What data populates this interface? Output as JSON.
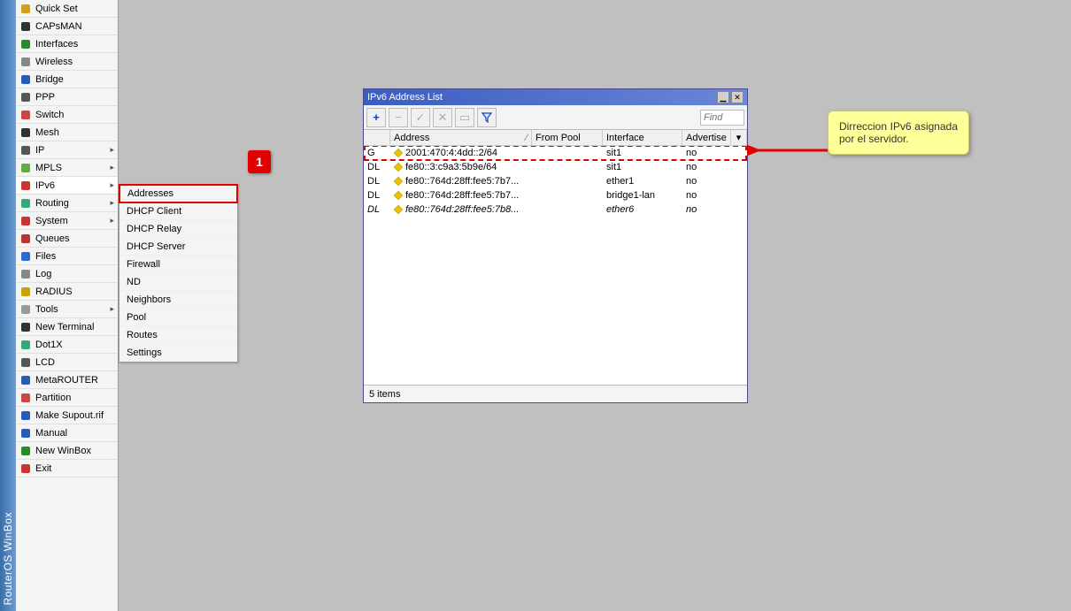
{
  "app_title": "RouterOS WinBox",
  "sidebar": {
    "items": [
      {
        "label": "Quick Set",
        "icon": "wand",
        "color": "#d4a017"
      },
      {
        "label": "CAPsMAN",
        "icon": "caps",
        "color": "#333"
      },
      {
        "label": "Interfaces",
        "icon": "iface",
        "color": "#2a8a2a"
      },
      {
        "label": "Wireless",
        "icon": "wifi",
        "color": "#888"
      },
      {
        "label": "Bridge",
        "icon": "bridge",
        "color": "#2a5ab8"
      },
      {
        "label": "PPP",
        "icon": "ppp",
        "color": "#555"
      },
      {
        "label": "Switch",
        "icon": "switch",
        "color": "#c44"
      },
      {
        "label": "Mesh",
        "icon": "mesh",
        "color": "#333"
      },
      {
        "label": "IP",
        "icon": "ip",
        "color": "#555",
        "arrow": true
      },
      {
        "label": "MPLS",
        "icon": "mpls",
        "color": "#6a4",
        "arrow": true
      },
      {
        "label": "IPv6",
        "icon": "ipv6",
        "color": "#c33",
        "arrow": true,
        "selected": true
      },
      {
        "label": "Routing",
        "icon": "routing",
        "color": "#3a7",
        "arrow": true
      },
      {
        "label": "System",
        "icon": "system",
        "color": "#c33",
        "arrow": true
      },
      {
        "label": "Queues",
        "icon": "queues",
        "color": "#b33"
      },
      {
        "label": "Files",
        "icon": "files",
        "color": "#2a6ad4"
      },
      {
        "label": "Log",
        "icon": "log",
        "color": "#888"
      },
      {
        "label": "RADIUS",
        "icon": "radius",
        "color": "#c9a400"
      },
      {
        "label": "Tools",
        "icon": "tools",
        "color": "#999",
        "arrow": true
      },
      {
        "label": "New Terminal",
        "icon": "term",
        "color": "#333"
      },
      {
        "label": "Dot1X",
        "icon": "dot1x",
        "color": "#3a7"
      },
      {
        "label": "LCD",
        "icon": "lcd",
        "color": "#555"
      },
      {
        "label": "MetaROUTER",
        "icon": "meta",
        "color": "#2a5ab8"
      },
      {
        "label": "Partition",
        "icon": "part",
        "color": "#c44"
      },
      {
        "label": "Make Supout.rif",
        "icon": "supout",
        "color": "#2a5ab8"
      },
      {
        "label": "Manual",
        "icon": "manual",
        "color": "#2a5ab8"
      },
      {
        "label": "New WinBox",
        "icon": "newwb",
        "color": "#2a8a2a"
      },
      {
        "label": "Exit",
        "icon": "exit",
        "color": "#c33"
      }
    ]
  },
  "submenu": {
    "items": [
      {
        "label": "Addresses",
        "highlighted": true
      },
      {
        "label": "DHCP Client"
      },
      {
        "label": "DHCP Relay"
      },
      {
        "label": "DHCP Server"
      },
      {
        "label": "Firewall"
      },
      {
        "label": "ND"
      },
      {
        "label": "Neighbors"
      },
      {
        "label": "Pool"
      },
      {
        "label": "Routes"
      },
      {
        "label": "Settings"
      }
    ]
  },
  "callout1": "1",
  "window": {
    "title": "IPv6 Address List",
    "toolbar": {
      "add": "+",
      "remove": "−",
      "enable": "✓",
      "disable": "✕",
      "comment": "▭",
      "filter": "▼"
    },
    "find_placeholder": "Find",
    "columns": {
      "flag": "",
      "address": "Address",
      "sort": "∕",
      "from_pool": "From Pool",
      "interface": "Interface",
      "advertise": "Advertise",
      "dropdown": "▾"
    },
    "rows": [
      {
        "flag": "G",
        "address": "2001:470:4:4dd::2/64",
        "from_pool": "",
        "interface": "sit1",
        "advertise": "no",
        "italic": false
      },
      {
        "flag": "DL",
        "address": "fe80::3:c9a3:5b9e/64",
        "from_pool": "",
        "interface": "sit1",
        "advertise": "no",
        "italic": false
      },
      {
        "flag": "DL",
        "address": "fe80::764d:28ff:fee5:7b7...",
        "from_pool": "",
        "interface": "ether1",
        "advertise": "no",
        "italic": false
      },
      {
        "flag": "DL",
        "address": "fe80::764d:28ff:fee5:7b7...",
        "from_pool": "",
        "interface": "bridge1-lan",
        "advertise": "no",
        "italic": false
      },
      {
        "flag": "DL",
        "address": "fe80::764d:28ff:fee5:7b8...",
        "from_pool": "",
        "interface": "ether6",
        "advertise": "no",
        "italic": true
      }
    ],
    "status": "5 items"
  },
  "note": "Dirreccion IPv6 asignada por el servidor."
}
